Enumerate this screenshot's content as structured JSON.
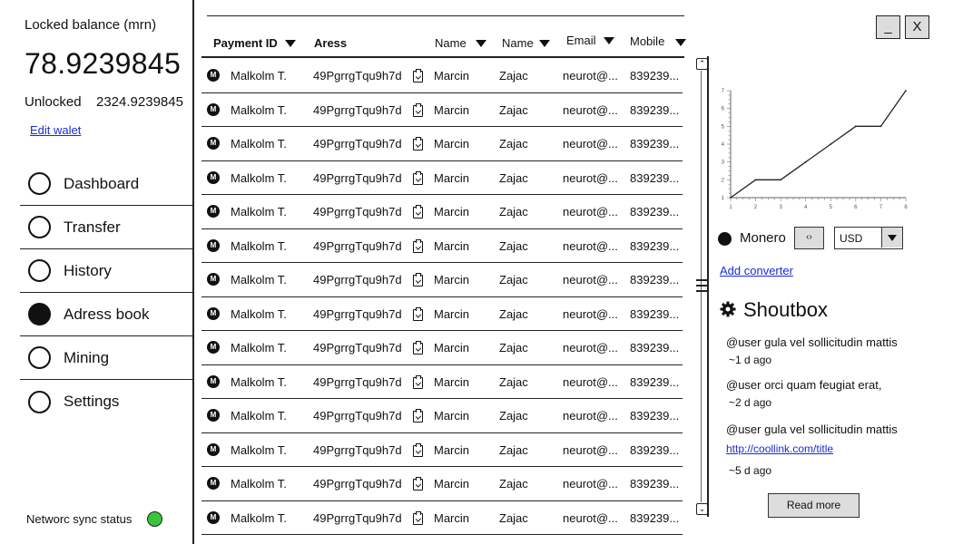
{
  "wallet": {
    "locked_label": "Locked balance (mrn)",
    "locked_value": "78.9239845",
    "unlocked_label": "Unlocked",
    "unlocked_value": "2324.9239845",
    "edit_link": "Edit walet"
  },
  "nav": {
    "items": [
      {
        "label": "Dashboard",
        "selected": false
      },
      {
        "label": "Transfer",
        "selected": false
      },
      {
        "label": "History",
        "selected": false
      },
      {
        "label": "Adress book",
        "selected": true
      },
      {
        "label": "Mining",
        "selected": false
      },
      {
        "label": "Settings",
        "selected": false
      }
    ]
  },
  "sync": {
    "label": "Networc sync status",
    "status_color": "#3bc43b"
  },
  "table": {
    "headers": {
      "payment_id": "Payment ID",
      "address": "Aress",
      "name1": "Name",
      "name2": "Name",
      "email": "Email",
      "mobile": "Mobile"
    },
    "rows": [
      {
        "payment_id": "Malkolm T.",
        "address": "49PgrrgTqu9h7d",
        "first": "Marcin",
        "last": "Zajac",
        "email": "neurot@...",
        "mobile": "839239..."
      },
      {
        "payment_id": "Malkolm T.",
        "address": "49PgrrgTqu9h7d",
        "first": "Marcin",
        "last": "Zajac",
        "email": "neurot@...",
        "mobile": "839239..."
      },
      {
        "payment_id": "Malkolm T.",
        "address": "49PgrrgTqu9h7d",
        "first": "Marcin",
        "last": "Zajac",
        "email": "neurot@...",
        "mobile": "839239..."
      },
      {
        "payment_id": "Malkolm T.",
        "address": "49PgrrgTqu9h7d",
        "first": "Marcin",
        "last": "Zajac",
        "email": "neurot@...",
        "mobile": "839239..."
      },
      {
        "payment_id": "Malkolm T.",
        "address": "49PgrrgTqu9h7d",
        "first": "Marcin",
        "last": "Zajac",
        "email": "neurot@...",
        "mobile": "839239..."
      },
      {
        "payment_id": "Malkolm T.",
        "address": "49PgrrgTqu9h7d",
        "first": "Marcin",
        "last": "Zajac",
        "email": "neurot@...",
        "mobile": "839239..."
      },
      {
        "payment_id": "Malkolm T.",
        "address": "49PgrrgTqu9h7d",
        "first": "Marcin",
        "last": "Zajac",
        "email": "neurot@...",
        "mobile": "839239..."
      },
      {
        "payment_id": "Malkolm T.",
        "address": "49PgrrgTqu9h7d",
        "first": "Marcin",
        "last": "Zajac",
        "email": "neurot@...",
        "mobile": "839239..."
      },
      {
        "payment_id": "Malkolm T.",
        "address": "49PgrrgTqu9h7d",
        "first": "Marcin",
        "last": "Zajac",
        "email": "neurot@...",
        "mobile": "839239..."
      },
      {
        "payment_id": "Malkolm T.",
        "address": "49PgrrgTqu9h7d",
        "first": "Marcin",
        "last": "Zajac",
        "email": "neurot@...",
        "mobile": "839239..."
      },
      {
        "payment_id": "Malkolm T.",
        "address": "49PgrrgTqu9h7d",
        "first": "Marcin",
        "last": "Zajac",
        "email": "neurot@...",
        "mobile": "839239..."
      },
      {
        "payment_id": "Malkolm T.",
        "address": "49PgrrgTqu9h7d",
        "first": "Marcin",
        "last": "Zajac",
        "email": "neurot@...",
        "mobile": "839239..."
      },
      {
        "payment_id": "Malkolm T.",
        "address": "49PgrrgTqu9h7d",
        "first": "Marcin",
        "last": "Zajac",
        "email": "neurot@...",
        "mobile": "839239..."
      },
      {
        "payment_id": "Malkolm T.",
        "address": "49PgrrgTqu9h7d",
        "first": "Marcin",
        "last": "Zajac",
        "email": "neurot@...",
        "mobile": "839239..."
      }
    ]
  },
  "window": {
    "minimize_label": "_",
    "close_label": "X"
  },
  "converter": {
    "currency_label": "Monero",
    "swap_label": "‹›",
    "selected_currency": "USD",
    "add_link": "Add converter"
  },
  "chart_data": {
    "type": "line",
    "x": [
      1,
      2,
      3,
      4,
      5,
      6,
      7,
      8
    ],
    "series": [
      {
        "values": [
          1,
          2,
          2,
          3,
          4,
          5,
          5,
          7
        ]
      }
    ],
    "xlim": [
      1,
      8
    ],
    "ylim": [
      1,
      7
    ],
    "x_ticks": [
      "1",
      "2",
      "3",
      "4",
      "5",
      "6",
      "7",
      "8"
    ],
    "y_ticks": [
      "1",
      "2",
      "3",
      "4",
      "5",
      "6",
      "7"
    ],
    "grid": false
  },
  "shoutbox": {
    "title": "Shoutbox",
    "messages": [
      {
        "text": "@user gula vel sollicitudin mattis",
        "time": "~1 d ago"
      },
      {
        "text": "@user orci quam feugiat erat,",
        "time": "~2 d ago"
      },
      {
        "text": "@user gula vel sollicitudin mattis",
        "link": "http://coollink.com/title",
        "time": "~5 d ago"
      }
    ],
    "read_more": "Read more"
  },
  "icons": {
    "coin": "monero-coin-icon",
    "copy": "clipboard-copy-icon",
    "gear": "gear-icon"
  }
}
